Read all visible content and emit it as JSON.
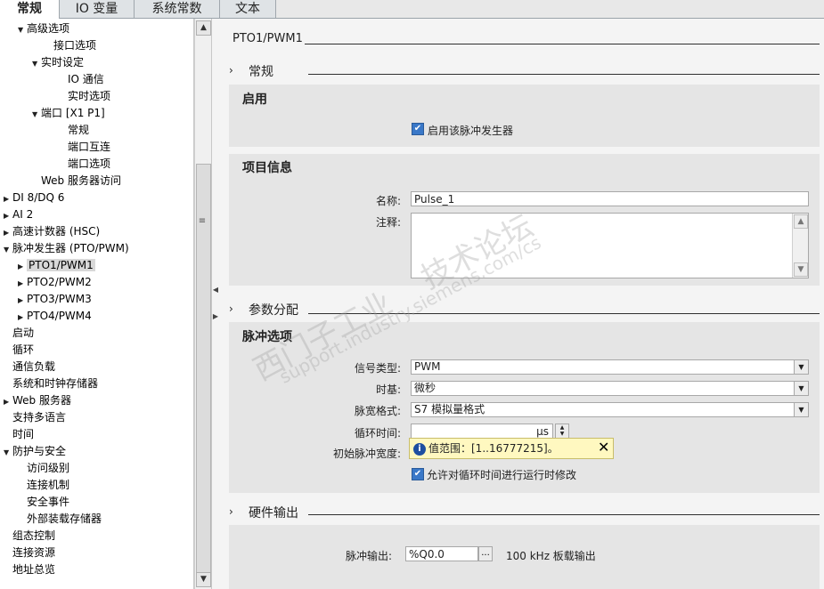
{
  "tabs": [
    {
      "label": "常规",
      "active": true
    },
    {
      "label": "IO 变量",
      "active": false
    },
    {
      "label": "系统常数",
      "active": false
    },
    {
      "label": "文本",
      "active": false
    }
  ],
  "tree": [
    {
      "label": "高级选项",
      "level": 1,
      "arrow": "▼"
    },
    {
      "label": "接口选项",
      "level": 3,
      "arrow": ""
    },
    {
      "label": "实时设定",
      "level": 2,
      "arrow": "▼"
    },
    {
      "label": "IO 通信",
      "level": 4,
      "arrow": ""
    },
    {
      "label": "实时选项",
      "level": 4,
      "arrow": ""
    },
    {
      "label": "端口 [X1 P1]",
      "level": 2,
      "arrow": "▼"
    },
    {
      "label": "常规",
      "level": 4,
      "arrow": ""
    },
    {
      "label": "端口互连",
      "level": 4,
      "arrow": ""
    },
    {
      "label": "端口选项",
      "level": 4,
      "arrow": ""
    },
    {
      "label": "Web 服务器访问",
      "level": 2,
      "arrow": ""
    },
    {
      "label": "DI 8/DQ 6",
      "level": 0,
      "arrow": "▶"
    },
    {
      "label": "AI 2",
      "level": 0,
      "arrow": "▶"
    },
    {
      "label": "高速计数器 (HSC)",
      "level": 0,
      "arrow": "▶"
    },
    {
      "label": "脉冲发生器 (PTO/PWM)",
      "level": 0,
      "arrow": "▼"
    },
    {
      "label": "PTO1/PWM1",
      "level": 1,
      "arrow": "▶",
      "selected": true
    },
    {
      "label": "PTO2/PWM2",
      "level": 1,
      "arrow": "▶"
    },
    {
      "label": "PTO3/PWM3",
      "level": 1,
      "arrow": "▶"
    },
    {
      "label": "PTO4/PWM4",
      "level": 1,
      "arrow": "▶"
    },
    {
      "label": "启动",
      "level": 0,
      "arrow": ""
    },
    {
      "label": "循环",
      "level": 0,
      "arrow": ""
    },
    {
      "label": "通信负载",
      "level": 0,
      "arrow": ""
    },
    {
      "label": "系统和时钟存储器",
      "level": 0,
      "arrow": ""
    },
    {
      "label": "Web 服务器",
      "level": 0,
      "arrow": "▶"
    },
    {
      "label": "支持多语言",
      "level": 0,
      "arrow": ""
    },
    {
      "label": "时间",
      "level": 0,
      "arrow": ""
    },
    {
      "label": "防护与安全",
      "level": 0,
      "arrow": "▼"
    },
    {
      "label": "访问级别",
      "level": 1,
      "arrow": ""
    },
    {
      "label": "连接机制",
      "level": 1,
      "arrow": ""
    },
    {
      "label": "安全事件",
      "level": 1,
      "arrow": ""
    },
    {
      "label": "外部装载存储器",
      "level": 1,
      "arrow": ""
    },
    {
      "label": "组态控制",
      "level": 0,
      "arrow": ""
    },
    {
      "label": "连接资源",
      "level": 0,
      "arrow": ""
    },
    {
      "label": "地址总览",
      "level": 0,
      "arrow": ""
    }
  ],
  "main": {
    "title": "PTO1/PWM1",
    "general": {
      "section": "常规",
      "enable_box": "启用",
      "enable_checkbox": "启用该脉冲发生器",
      "project_box": "项目信息",
      "name_label": "名称:",
      "name_value": "Pulse_1",
      "comment_label": "注释:",
      "comment_value": ""
    },
    "params": {
      "section": "参数分配",
      "box": "脉冲选项",
      "signal_label": "信号类型:",
      "signal_value": "PWM",
      "timebase_label": "时基:",
      "timebase_value": "微秒",
      "format_label": "脉宽格式:",
      "format_value": "S7 模拟量格式",
      "cycle_label": "循环时间:",
      "cycle_value": "",
      "cycle_unit": "µs",
      "initial_label": "初始脉冲宽度:",
      "tooltip": "值范围：[1..16777215]。",
      "runtime_checkbox": "允许对循环时间进行运行时修改"
    },
    "hw": {
      "section": "硬件输出",
      "output_label": "脉冲输出:",
      "output_value": "%Q0.0",
      "browse_label": "...",
      "output_desc": "100 kHz 板载输出"
    },
    "watermark": {
      "line1": "西门子工业",
      "line2": "技术论坛",
      "line3": "support.industry.siemens.com/cs"
    }
  }
}
